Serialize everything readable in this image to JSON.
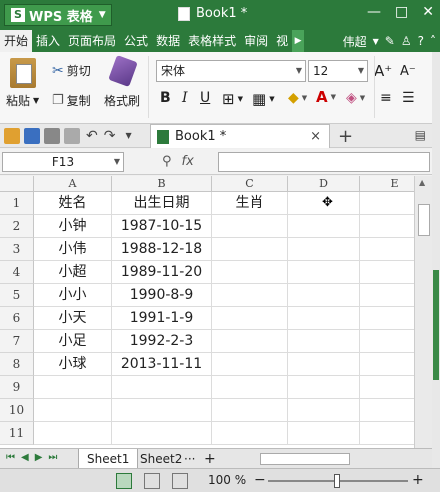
{
  "titlebar": {
    "app_label": "WPS 表格",
    "app_glyph": "S",
    "doc_title": "Book1 *",
    "win_buttons": [
      "—",
      "□",
      "✕"
    ]
  },
  "menubar": {
    "items": [
      "开始",
      "插入",
      "页面布局",
      "公式",
      "数据",
      "表格样式",
      "审阅",
      "视"
    ],
    "user": "伟超"
  },
  "ribbon": {
    "paste_label": "粘贴",
    "cut_label": "剪切",
    "copy_label": "复制",
    "format_painter_label": "格式刷",
    "font_name": "宋体",
    "font_size": "12",
    "grow_font": "A⁺",
    "shrink_font": "A⁻",
    "bold": "B",
    "italic": "I",
    "underline": "U",
    "font_color_glyph": "A"
  },
  "colors": {
    "accent": "#2c7a3b",
    "accent_light": "#3f9a4c"
  },
  "doc_tab": {
    "label": "Book1 *",
    "close": "×",
    "add": "+"
  },
  "formula_bar": {
    "cell_ref": "F13",
    "zoom_icon": "search-icon",
    "fx": "fx"
  },
  "grid": {
    "columns": [
      "A",
      "B",
      "C",
      "D",
      "E"
    ],
    "rows": [
      "1",
      "2",
      "3",
      "4",
      "5",
      "6",
      "7",
      "8",
      "9",
      "10",
      "11"
    ],
    "cells": [
      [
        "姓名",
        "出生日期",
        "生肖",
        "",
        ""
      ],
      [
        "小钟",
        "1987-10-15",
        "",
        "",
        ""
      ],
      [
        "小伟",
        "1988-12-18",
        "",
        "",
        ""
      ],
      [
        "小超",
        "1989-11-20",
        "",
        "",
        ""
      ],
      [
        "小小",
        "1990-8-9",
        "",
        "",
        ""
      ],
      [
        "小天",
        "1991-1-9",
        "",
        "",
        ""
      ],
      [
        "小足",
        "1992-2-3",
        "",
        "",
        ""
      ],
      [
        "小球",
        "2013-11-11",
        "",
        "",
        ""
      ],
      [
        "",
        "",
        "",
        "",
        ""
      ],
      [
        "",
        "",
        "",
        "",
        ""
      ],
      [
        "",
        "",
        "",
        "",
        ""
      ]
    ]
  },
  "sheets": {
    "tabs": [
      "Sheet1",
      "Sheet2"
    ],
    "active": "Sheet1",
    "more": "···",
    "add": "+"
  },
  "statusbar": {
    "zoom": "100 %",
    "zoom_percent": 100
  }
}
